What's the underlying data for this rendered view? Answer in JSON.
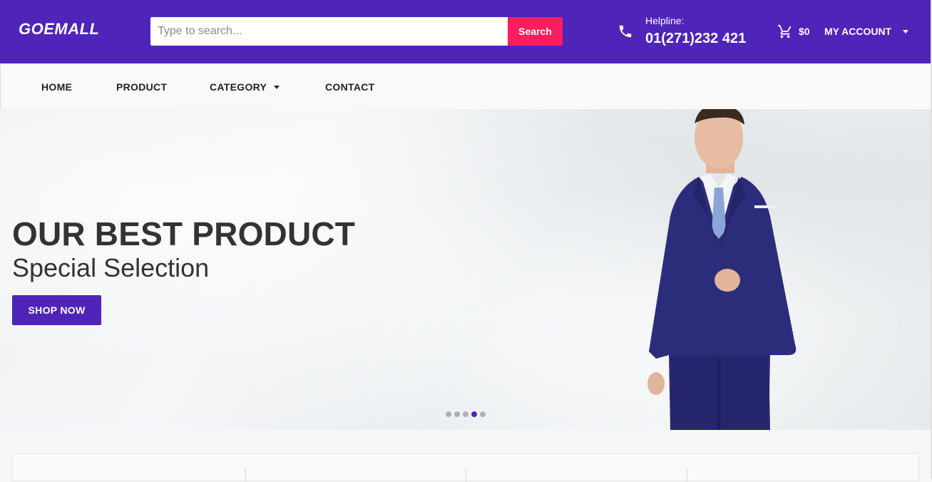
{
  "header": {
    "logo": "GOEMALL",
    "search_placeholder": "Type to search...",
    "search_button": "Search",
    "helpline_label": "Helpline:",
    "helpline_number": "01(271)232 421",
    "cart_total": "$0",
    "account_label": "MY ACCOUNT"
  },
  "nav": {
    "items": [
      {
        "label": "HOME"
      },
      {
        "label": "PRODUCT"
      },
      {
        "label": "CATEGORY"
      },
      {
        "label": "CONTACT"
      }
    ]
  },
  "hero": {
    "title": "OUR BEST PRODUCT",
    "subtitle": "Special Selection",
    "cta": "SHOP NOW",
    "slide_count": 5,
    "active_slide": 4
  },
  "colors": {
    "brand": "#4f24b8",
    "accent": "#ff1c5f"
  },
  "icons": [
    "phone-icon",
    "cart-icon",
    "chevron-down-icon"
  ]
}
